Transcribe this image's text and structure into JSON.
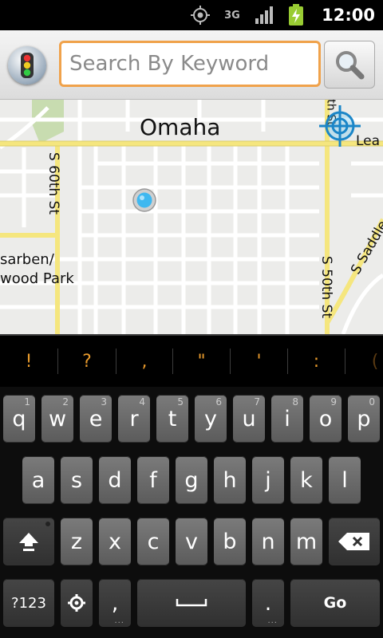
{
  "status_bar": {
    "time": "12:00",
    "network": "3G",
    "icons": [
      "gps-icon",
      "network-3g-icon",
      "signal-icon",
      "battery-charging-icon"
    ]
  },
  "header": {
    "search_placeholder": "Search By Keyword",
    "search_value": "",
    "logo_icon": "traffic-light-icon",
    "search_icon": "magnifier-icon",
    "search_border_color": "#f0a24b"
  },
  "map": {
    "labels": {
      "city": "Omaha",
      "s60th": "S 60th St",
      "s50th": "S 50th St",
      "saddle": "S Saddle Cr",
      "aksarben1": "sarben/",
      "aksarben2": "wood Park",
      "lea": "Lea",
      "th_st": "th St"
    },
    "road_color": "#f5e67e",
    "marker_color": "#3fb8f0"
  },
  "suggestions": [
    "!",
    "?",
    ",",
    "\"",
    "'",
    ":",
    "("
  ],
  "keyboard": {
    "row1": [
      {
        "key": "q",
        "hint": "1"
      },
      {
        "key": "w",
        "hint": "2"
      },
      {
        "key": "e",
        "hint": "3"
      },
      {
        "key": "r",
        "hint": "4"
      },
      {
        "key": "t",
        "hint": "5"
      },
      {
        "key": "y",
        "hint": "6"
      },
      {
        "key": "u",
        "hint": "7"
      },
      {
        "key": "i",
        "hint": "8"
      },
      {
        "key": "o",
        "hint": "9"
      },
      {
        "key": "p",
        "hint": "0"
      }
    ],
    "row2": [
      "a",
      "s",
      "d",
      "f",
      "g",
      "h",
      "j",
      "k",
      "l"
    ],
    "row3": [
      "z",
      "x",
      "c",
      "v",
      "b",
      "n",
      "m"
    ],
    "symbols_label": "?123",
    "comma_label": ",",
    "period_label": ".",
    "go_label": "Go"
  }
}
